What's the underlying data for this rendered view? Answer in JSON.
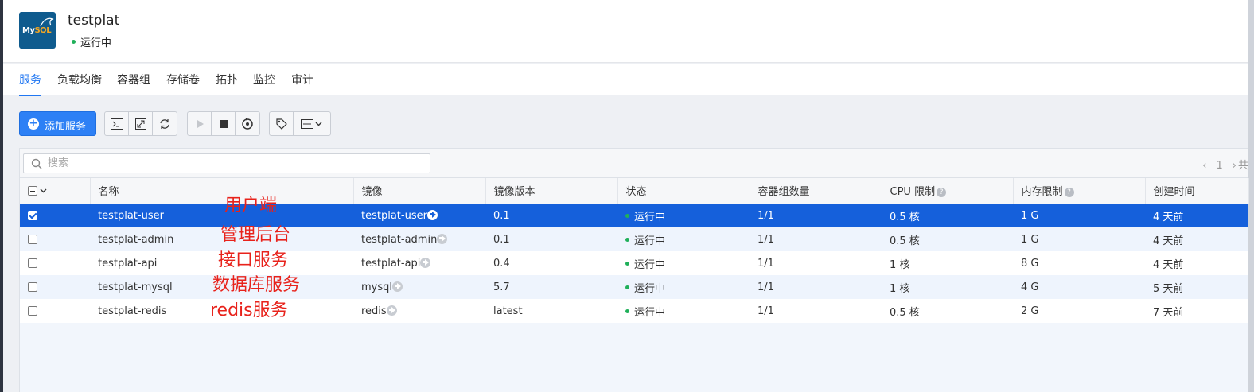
{
  "app": {
    "logo_text_a": "My",
    "logo_text_b": "SQL",
    "title": "testplat",
    "status": "运行中"
  },
  "tabs": [
    {
      "label": "服务",
      "active": true
    },
    {
      "label": "负载均衡"
    },
    {
      "label": "容器组"
    },
    {
      "label": "存储卷"
    },
    {
      "label": "拓扑"
    },
    {
      "label": "监控"
    },
    {
      "label": "审计"
    }
  ],
  "toolbar": {
    "add_service_label": "添加服务",
    "icons": [
      "terminal-icon",
      "expand-icon",
      "refresh-icon",
      "play-icon",
      "stop-icon",
      "restart-icon",
      "tag-icon",
      "columns-icon"
    ]
  },
  "search": {
    "placeholder": "搜索"
  },
  "pager": {
    "current": "1",
    "total_prefix": "共"
  },
  "table": {
    "headers": [
      "名称",
      "镜像",
      "镜像版本",
      "状态",
      "容器组数量",
      "CPU 限制",
      "内存限制",
      "创建时间"
    ],
    "rows": [
      {
        "name": "testplat-user",
        "image": "testplat-user",
        "version": "0.1",
        "status": "运行中",
        "pods": "1/1",
        "cpu": "0.5 核",
        "mem": "1 G",
        "created": "4 天前",
        "selected": true
      },
      {
        "name": "testplat-admin",
        "image": "testplat-admin",
        "version": "0.1",
        "status": "运行中",
        "pods": "1/1",
        "cpu": "0.5 核",
        "mem": "1 G",
        "created": "4 天前"
      },
      {
        "name": "testplat-api",
        "image": "testplat-api",
        "version": "0.4",
        "status": "运行中",
        "pods": "1/1",
        "cpu": "1 核",
        "mem": "8 G",
        "created": "4 天前"
      },
      {
        "name": "testplat-mysql",
        "image": "mysql",
        "version": "5.7",
        "status": "运行中",
        "pods": "1/1",
        "cpu": "1 核",
        "mem": "4 G",
        "created": "5 天前"
      },
      {
        "name": "testplat-redis",
        "image": "redis",
        "version": "latest",
        "status": "运行中",
        "pods": "1/1",
        "cpu": "0.5 核",
        "mem": "2 G",
        "created": "7 天前"
      }
    ]
  },
  "annotations": [
    "用户端",
    "管理后台",
    "接口服务",
    "数据库服务",
    "redis服务"
  ],
  "colors": {
    "accent": "#2177f2",
    "selected_row": "#1560db",
    "status_dot": "#20b05a",
    "annotation": "#e8221b"
  }
}
